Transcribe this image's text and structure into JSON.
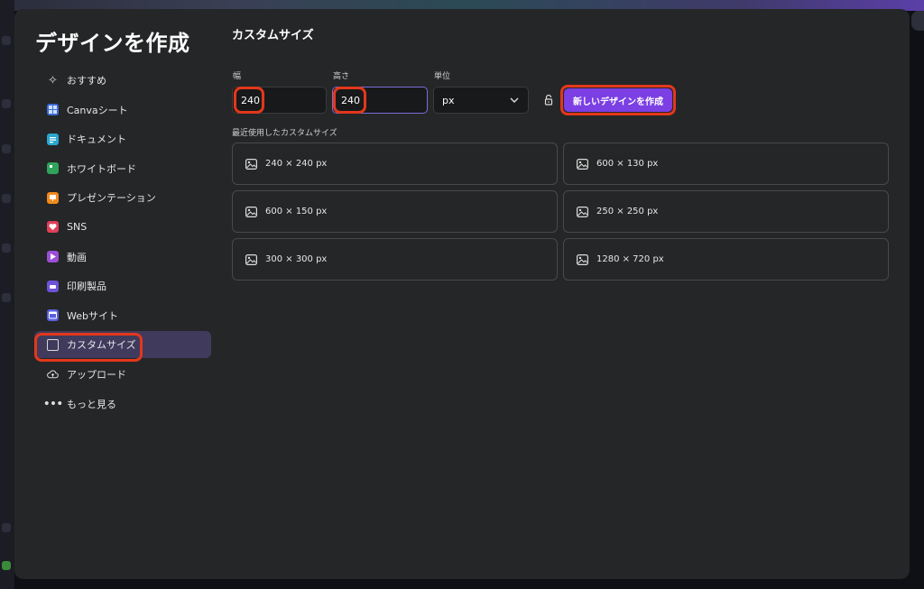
{
  "modal": {
    "title": "デザインを作成"
  },
  "sidebar": {
    "items": [
      {
        "label": "おすすめ",
        "icon": "sparkle-icon"
      },
      {
        "label": "Canvaシート",
        "icon": "sheet-icon"
      },
      {
        "label": "ドキュメント",
        "icon": "doc-icon"
      },
      {
        "label": "ホワイトボード",
        "icon": "whiteboard-icon"
      },
      {
        "label": "プレゼンテーション",
        "icon": "presentation-icon"
      },
      {
        "label": "SNS",
        "icon": "heart-icon"
      },
      {
        "label": "動画",
        "icon": "video-icon"
      },
      {
        "label": "印刷製品",
        "icon": "print-icon"
      },
      {
        "label": "Webサイト",
        "icon": "website-icon"
      },
      {
        "label": "カスタムサイズ",
        "icon": "custom-size-icon",
        "active": true
      },
      {
        "label": "アップロード",
        "icon": "upload-cloud-icon"
      },
      {
        "label": "もっと見る",
        "icon": "more-dots-icon"
      }
    ]
  },
  "custom": {
    "section_title": "カスタムサイズ",
    "width_label": "幅",
    "width_value": "240",
    "height_label": "高さ",
    "height_value": "240",
    "unit_label": "単位",
    "unit_value": "px",
    "create_button": "新しいデザインを作成",
    "recent_label": "最近使用したカスタムサイズ",
    "recent": [
      "240 × 240 px",
      "600 × 130 px",
      "600 × 150 px",
      "250 × 250 px",
      "300 × 300 px",
      "1280 × 720 px"
    ]
  },
  "colors": {
    "accent": "#7b3fe4",
    "highlight": "#e4371b",
    "active_item_bg": "#403a5c"
  }
}
